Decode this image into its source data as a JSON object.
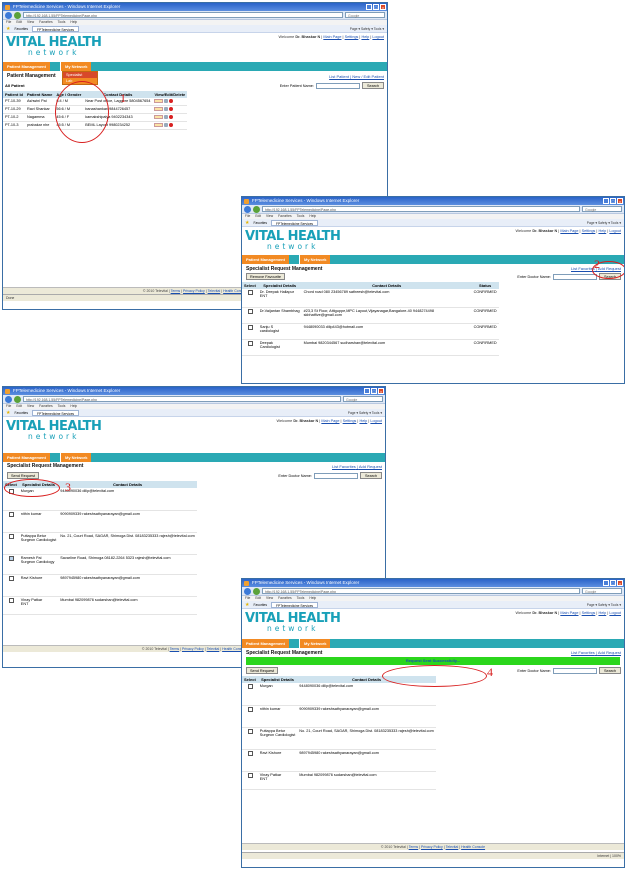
{
  "browser": {
    "title": "FPTelemedicine Services - Windows Internet Explorer",
    "address": "http://192.168.1.55/FPTelemedicine/Page.php",
    "search_placeholder": "Google",
    "menu": [
      "File",
      "Edit",
      "View",
      "Favorites",
      "Tools",
      "Help"
    ],
    "favorites_label": "Favorites",
    "tab_label": "FPTelemedicine Services",
    "tools_text": "Page ▾  Safety ▾  Tools ▾",
    "status_left": "Done",
    "status_internet": "Internet",
    "status_zoom": "100%"
  },
  "site": {
    "logo_main": "VITAL HEALTH",
    "logo_sub": "network",
    "welcome_prefix": "Welcome",
    "user": "Dr. Bhaskar N",
    "links": [
      "Main Page",
      "Settings",
      "Help",
      "Logout"
    ],
    "nav_patient": "Patient Management",
    "nav_network": "My Network",
    "footer_text": "© 2010 Televital",
    "footer_links": [
      "Terms",
      "Privacy Policy",
      "Televital",
      "Health Console"
    ]
  },
  "step_labels": [
    "1",
    "2",
    "3",
    "4"
  ],
  "screen1": {
    "heading": "Patient Management",
    "dropdown": [
      "Specialist",
      "Lab"
    ],
    "links": "List Patient | New / Edit Patient",
    "filter_label": "All Patient",
    "search_label": "Enter Patient Name:",
    "search_button": "Search",
    "columns": [
      "Patient Id",
      "Patient Name",
      "Age / Gender",
      "Contact Details",
      "View/Edit/Delete"
    ],
    "rows": [
      {
        "id": "PT-10-39",
        "name": "Ashwini Pai",
        "age": "8:4 / M",
        "contact": "Near Post office, Laggere 5804567654"
      },
      {
        "id": "PT-10-29",
        "name": "Ravi Shankar",
        "age": "56:6 / M",
        "contact": "banashankari 9844726457"
      },
      {
        "id": "PT-10-2",
        "name": "Nagamma",
        "age": "45:6 / F",
        "contact": "kamakshipalya 9402234343"
      },
      {
        "id": "PT-10-3",
        "name": "prabakar nhe",
        "age": "45:5 / M",
        "contact": "BEML Layout 9980234252"
      }
    ]
  },
  "screen2": {
    "heading": "Specialist Request Management",
    "links_a": "List Favorites",
    "links_b": "Add Request",
    "remove_button": "Remove Favourite",
    "search_label": "Enter Doctor Name:",
    "search_button": "Search",
    "columns": [
      "Select",
      "Specialist Details",
      "Contact Details",
      "Status"
    ],
    "rows": [
      {
        "name": "Dr. Deepak  Hallapur",
        "spec": "ENT",
        "contact": "Chord road 080 23456789 satheesh@televital.com",
        "status": "CONFIRMED"
      },
      {
        "name": "Dr.Vaijantan Shambhag",
        "spec": "",
        "contact": "#23,3 St Floor, Attiguppe,MPC Layout,Vijayanagar,Bangalore-40 9448274498 skbhatfive@gmail.com",
        "status": "CONFIRMED"
      },
      {
        "name": "Sanju S",
        "spec": "cardiologist",
        "contact": "9448090033 dilip443@hotmail.com",
        "status": "CONFIRMED"
      },
      {
        "name": "Deepak",
        "spec": "Cardiologist",
        "contact": "Mumbai 9820344567 sudharshan@televital.com",
        "status": "CONFIRMED"
      }
    ]
  },
  "screen3": {
    "heading": "Specialist Request Management",
    "links_a": "List Favorites",
    "links_b": "Add Request",
    "send_button": "Send Request",
    "search_label": "Enter Doctor Name:",
    "search_button": "Search",
    "columns": [
      "Select",
      "Specialist Details",
      "Contact Details"
    ],
    "rows": [
      {
        "name": "Murgan",
        "spec": "",
        "contact": "9448090036 dilip@televital.com",
        "checked": false
      },
      {
        "name": "nithin kumar",
        "spec": "",
        "contact": "9090909339 rakeshsathyanarayan@gmail.com",
        "checked": false
      },
      {
        "name": "Puttappa Betur",
        "spec": "Surgeon Cardiologist",
        "contact": "No. 21, Court Road, SAGAR, Shimoga Dist. 08183235333 rajesh@televital.com",
        "checked": false
      },
      {
        "name": "Ramesh Pai",
        "spec": "Surgeon Cardiology",
        "contact": "Savarline Road, Shimoga 08182-2264 5323 rajesh@televital.com",
        "checked": true
      },
      {
        "name": "Ravi Kishore",
        "spec": "",
        "contact": "9897945980 rakeshsathyanarayan@gmail.com",
        "checked": false
      },
      {
        "name": "Vinay Patkar",
        "spec": "ENT",
        "contact": "Mumbai 982099876 sudarshan@televital.com",
        "checked": false
      }
    ]
  },
  "screen4": {
    "heading": "Specialist Request Management",
    "links_a": "List Favorites",
    "links_b": "Add Request",
    "message": "Request Sent Successfully...",
    "send_button": "Send Request",
    "search_label": "Enter Doctor Name:",
    "search_button": "Search",
    "columns": [
      "Select",
      "Specialist Details",
      "Contact Details"
    ],
    "rows": [
      {
        "name": "Murgan",
        "spec": "",
        "contact": "9448090036 dilip@televital.com"
      },
      {
        "name": "nithin kumar",
        "spec": "",
        "contact": "9090909339 rakeshsathyanarayan@gmail.com"
      },
      {
        "name": "Puttappa Betur",
        "spec": "Surgeon Cardiologist",
        "contact": "No. 21, Court Road, SAGAR, Shimoga Dist. 08183235333 rajesh@televital.com"
      },
      {
        "name": "Ravi Kishore",
        "spec": "",
        "contact": "9897945980 rakeshsathyanarayan@gmail.com"
      },
      {
        "name": "Vinay Patkar",
        "spec": "ENT",
        "contact": "Mumbai 982099876 sudarshan@televital.com"
      }
    ]
  }
}
